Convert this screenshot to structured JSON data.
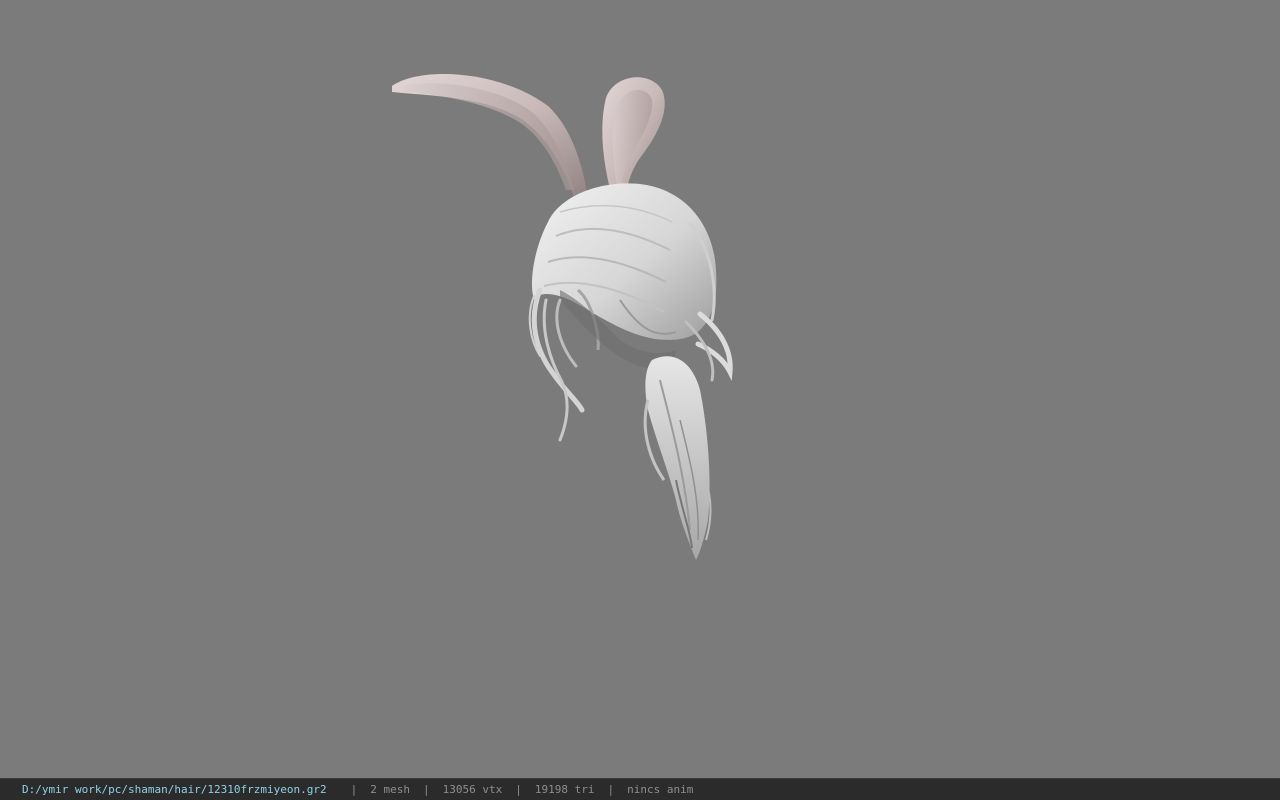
{
  "viewport": {
    "background_color": "#7b7b7b",
    "model_name": "bunny-ear-hair-model"
  },
  "statusbar": {
    "file_path": "D:/ymir work/pc/shaman/hair/12310frzmiyeon.gr2",
    "separator": "|",
    "mesh_count": "2 mesh",
    "vertex_count": "13056 vtx",
    "triangle_count": "19198 tri",
    "anim_status": "nincs anim",
    "path_color": "#8fd0e6",
    "text_color": "#8e8e8e",
    "background_color": "#2b2b2b"
  }
}
